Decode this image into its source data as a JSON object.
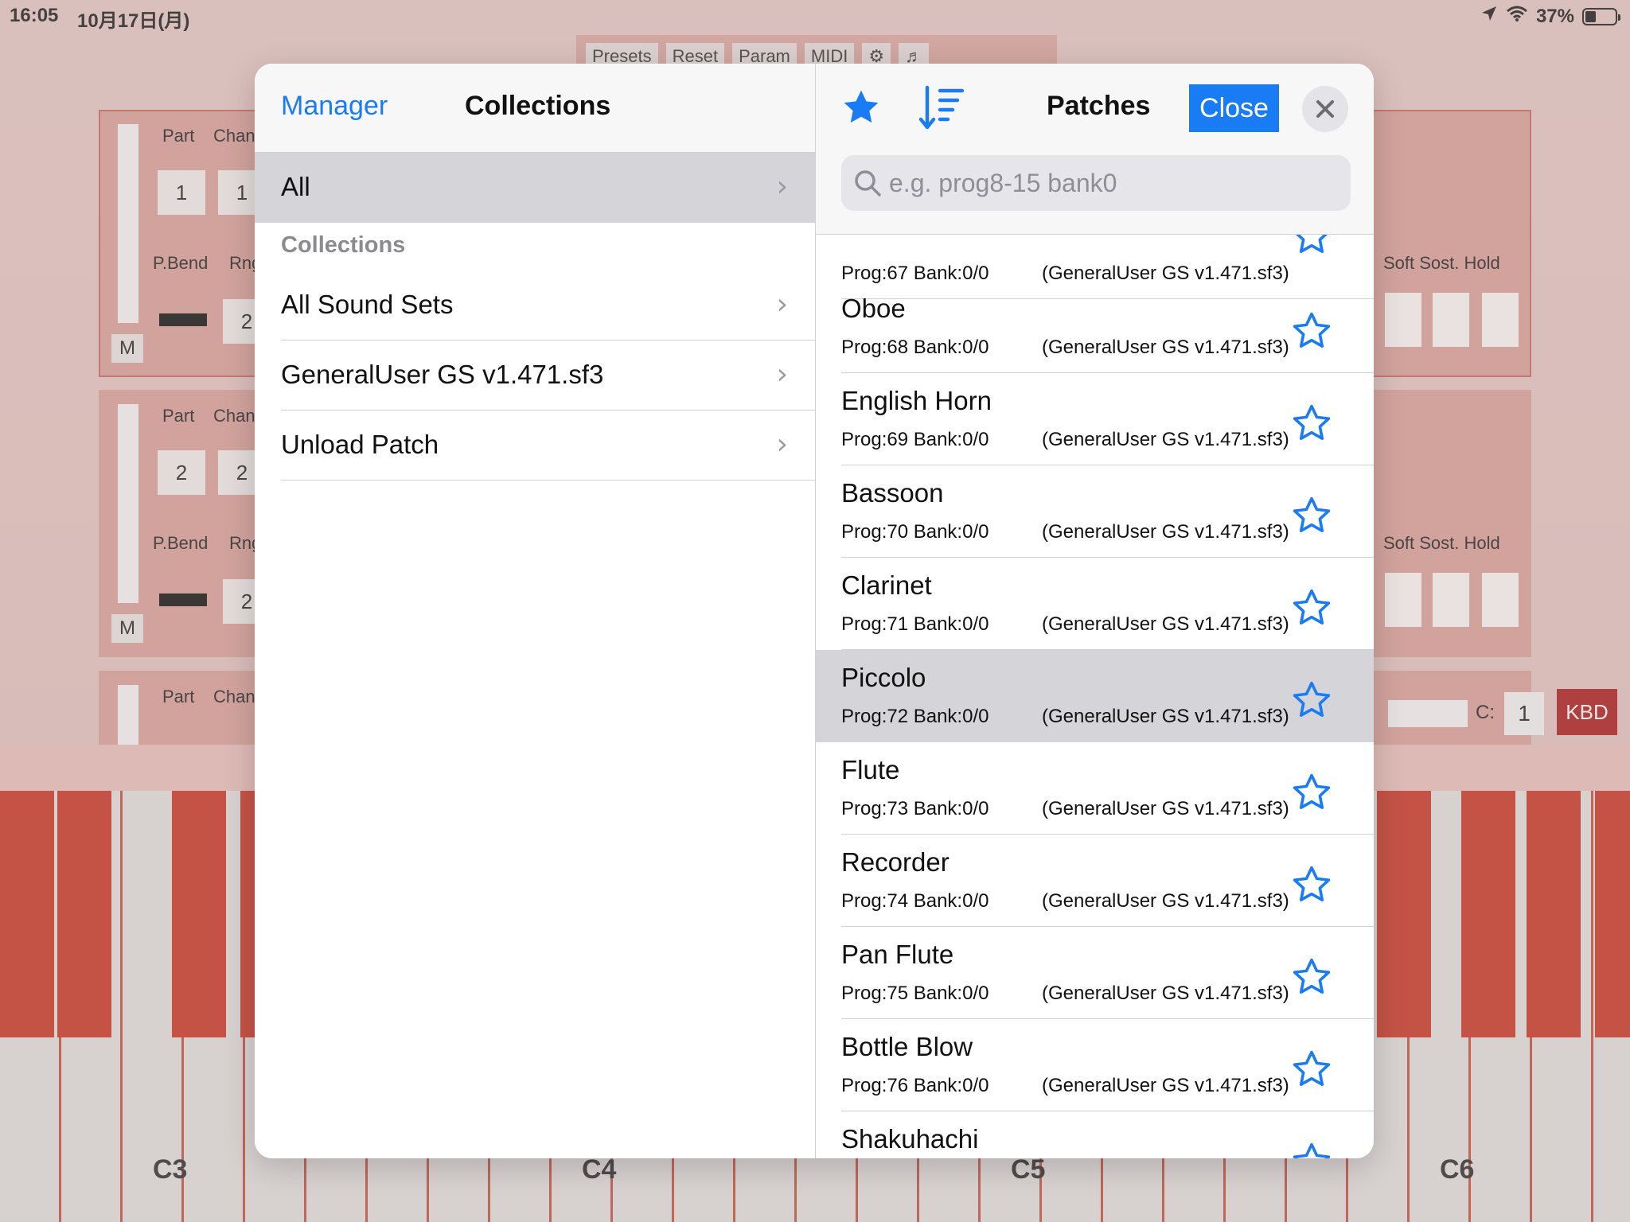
{
  "status_bar": {
    "time": "16:05",
    "date": "10月17日(月)",
    "battery": "37%",
    "battery_level": 0.37
  },
  "background_app": {
    "top_tabs": [
      "Presets",
      "Reset",
      "Param",
      "MIDI",
      "⚙",
      "♬"
    ],
    "part_label": "Part",
    "channel_label": "Chan",
    "pbend_label": "P.Bend",
    "rng_label": "Rng",
    "mute_label": "M",
    "part1_value": "1",
    "part1_chan": "1",
    "part1_rng": "2",
    "part2_value": "2",
    "part2_chan": "2",
    "part2_rng": "2",
    "pedal_labels": "Soft Sost. Hold",
    "channel_short": "C:",
    "channel_value": "1",
    "kbd_button": "KBD",
    "octave_labels": [
      "C3",
      "C4",
      "C5",
      "C6"
    ]
  },
  "modal": {
    "left": {
      "manager_link": "Manager",
      "title": "Collections",
      "all_row": "All",
      "section_header": "Collections",
      "items": [
        {
          "label": "All Sound Sets"
        },
        {
          "label": "GeneralUser GS v1.471.sf3"
        },
        {
          "label": "Unload Patch"
        }
      ]
    },
    "right": {
      "title": "Patches",
      "close_label": "Close",
      "search_placeholder": "e.g. prog8-15 bank0",
      "partial_top_meta": "Prog:67 Bank:0/0",
      "partial_top_src": "(GeneralUser GS v1.471.sf3)",
      "patches": [
        {
          "name": "Oboe",
          "meta": "Prog:68 Bank:0/0",
          "src": "(GeneralUser GS v1.471.sf3)"
        },
        {
          "name": "English Horn",
          "meta": "Prog:69 Bank:0/0",
          "src": "(GeneralUser GS v1.471.sf3)"
        },
        {
          "name": "Bassoon",
          "meta": "Prog:70 Bank:0/0",
          "src": "(GeneralUser GS v1.471.sf3)"
        },
        {
          "name": "Clarinet",
          "meta": "Prog:71 Bank:0/0",
          "src": "(GeneralUser GS v1.471.sf3)"
        },
        {
          "name": "Piccolo",
          "meta": "Prog:72 Bank:0/0",
          "src": "(GeneralUser GS v1.471.sf3)"
        },
        {
          "name": "Flute",
          "meta": "Prog:73 Bank:0/0",
          "src": "(GeneralUser GS v1.471.sf3)"
        },
        {
          "name": "Recorder",
          "meta": "Prog:74 Bank:0/0",
          "src": "(GeneralUser GS v1.471.sf3)"
        },
        {
          "name": "Pan Flute",
          "meta": "Prog:75 Bank:0/0",
          "src": "(GeneralUser GS v1.471.sf3)"
        },
        {
          "name": "Bottle Blow",
          "meta": "Prog:76 Bank:0/0",
          "src": "(GeneralUser GS v1.471.sf3)"
        },
        {
          "name": "Shakuhachi",
          "meta": "",
          "src": ""
        }
      ],
      "selected_patch": "Piccolo"
    }
  },
  "colors": {
    "accent": "#1a7cf4",
    "selected_row": "#d4d4d9",
    "kbd_red": "#9e1b1b",
    "key_red": "#b73323"
  }
}
